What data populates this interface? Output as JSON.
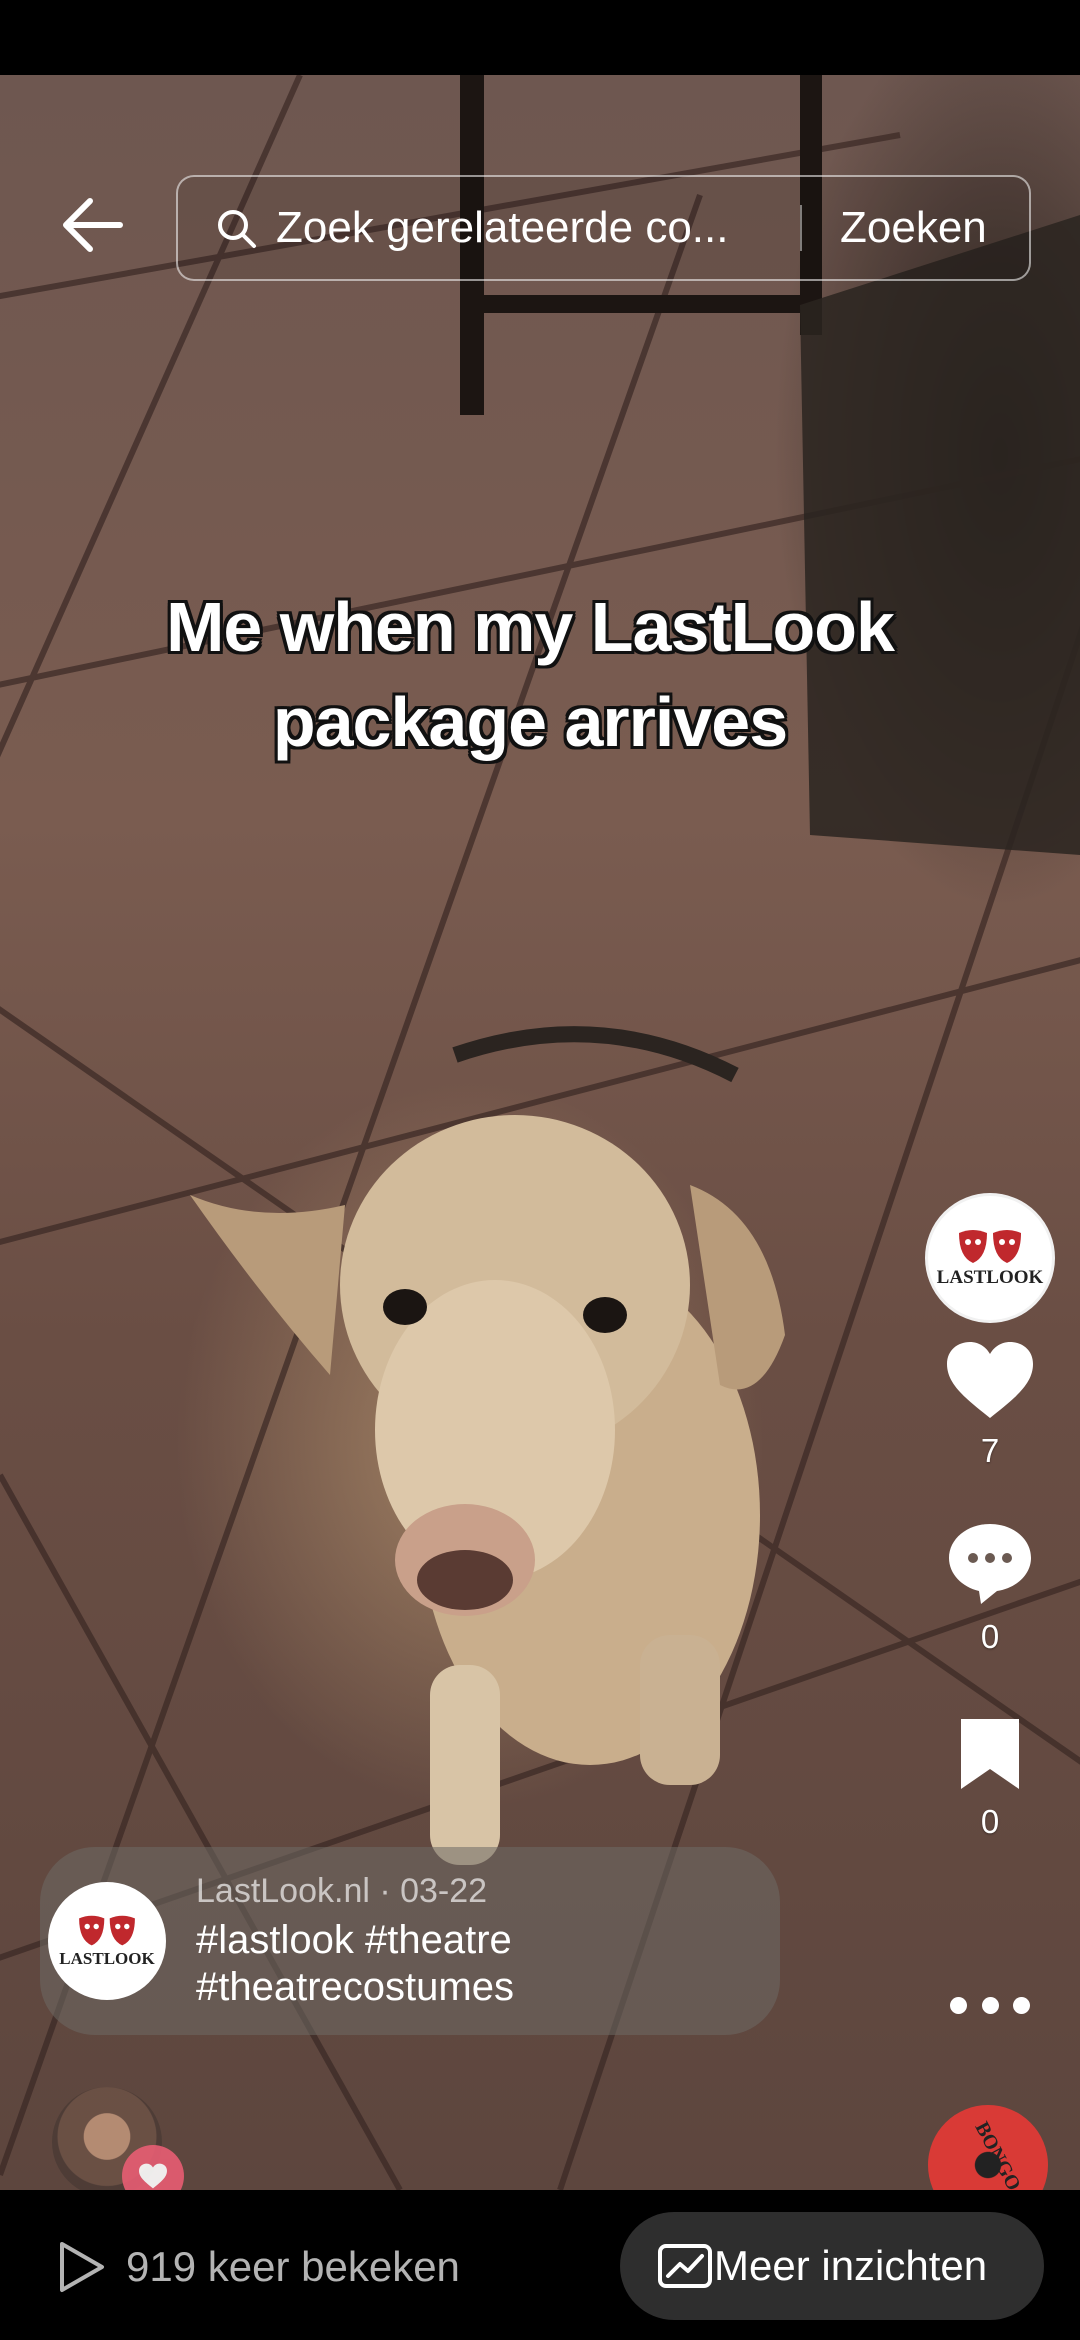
{
  "search": {
    "placeholder": "Zoek gerelateerde co...",
    "submit_label": "Zoeken"
  },
  "video": {
    "caption_lines": [
      "Me when my LastLook",
      "package arrives"
    ]
  },
  "creator": {
    "logo_text": "LASTLOOK"
  },
  "actions": {
    "likes": "7",
    "comments": "0",
    "saves": "0"
  },
  "post": {
    "author_line": "LastLook.nl · 03-22",
    "hashtags_line1": "#lastlook #theatre",
    "hashtags_line2": "#theatrecostumes"
  },
  "sound": {
    "label": "BONGO"
  },
  "bottom": {
    "views_text": "919 keer bekeken",
    "insights_label": "Meer inzichten"
  },
  "colors": {
    "logo_red": "#c0282d",
    "heart_badge": "#e85d73",
    "disc_red": "#d93a36"
  }
}
